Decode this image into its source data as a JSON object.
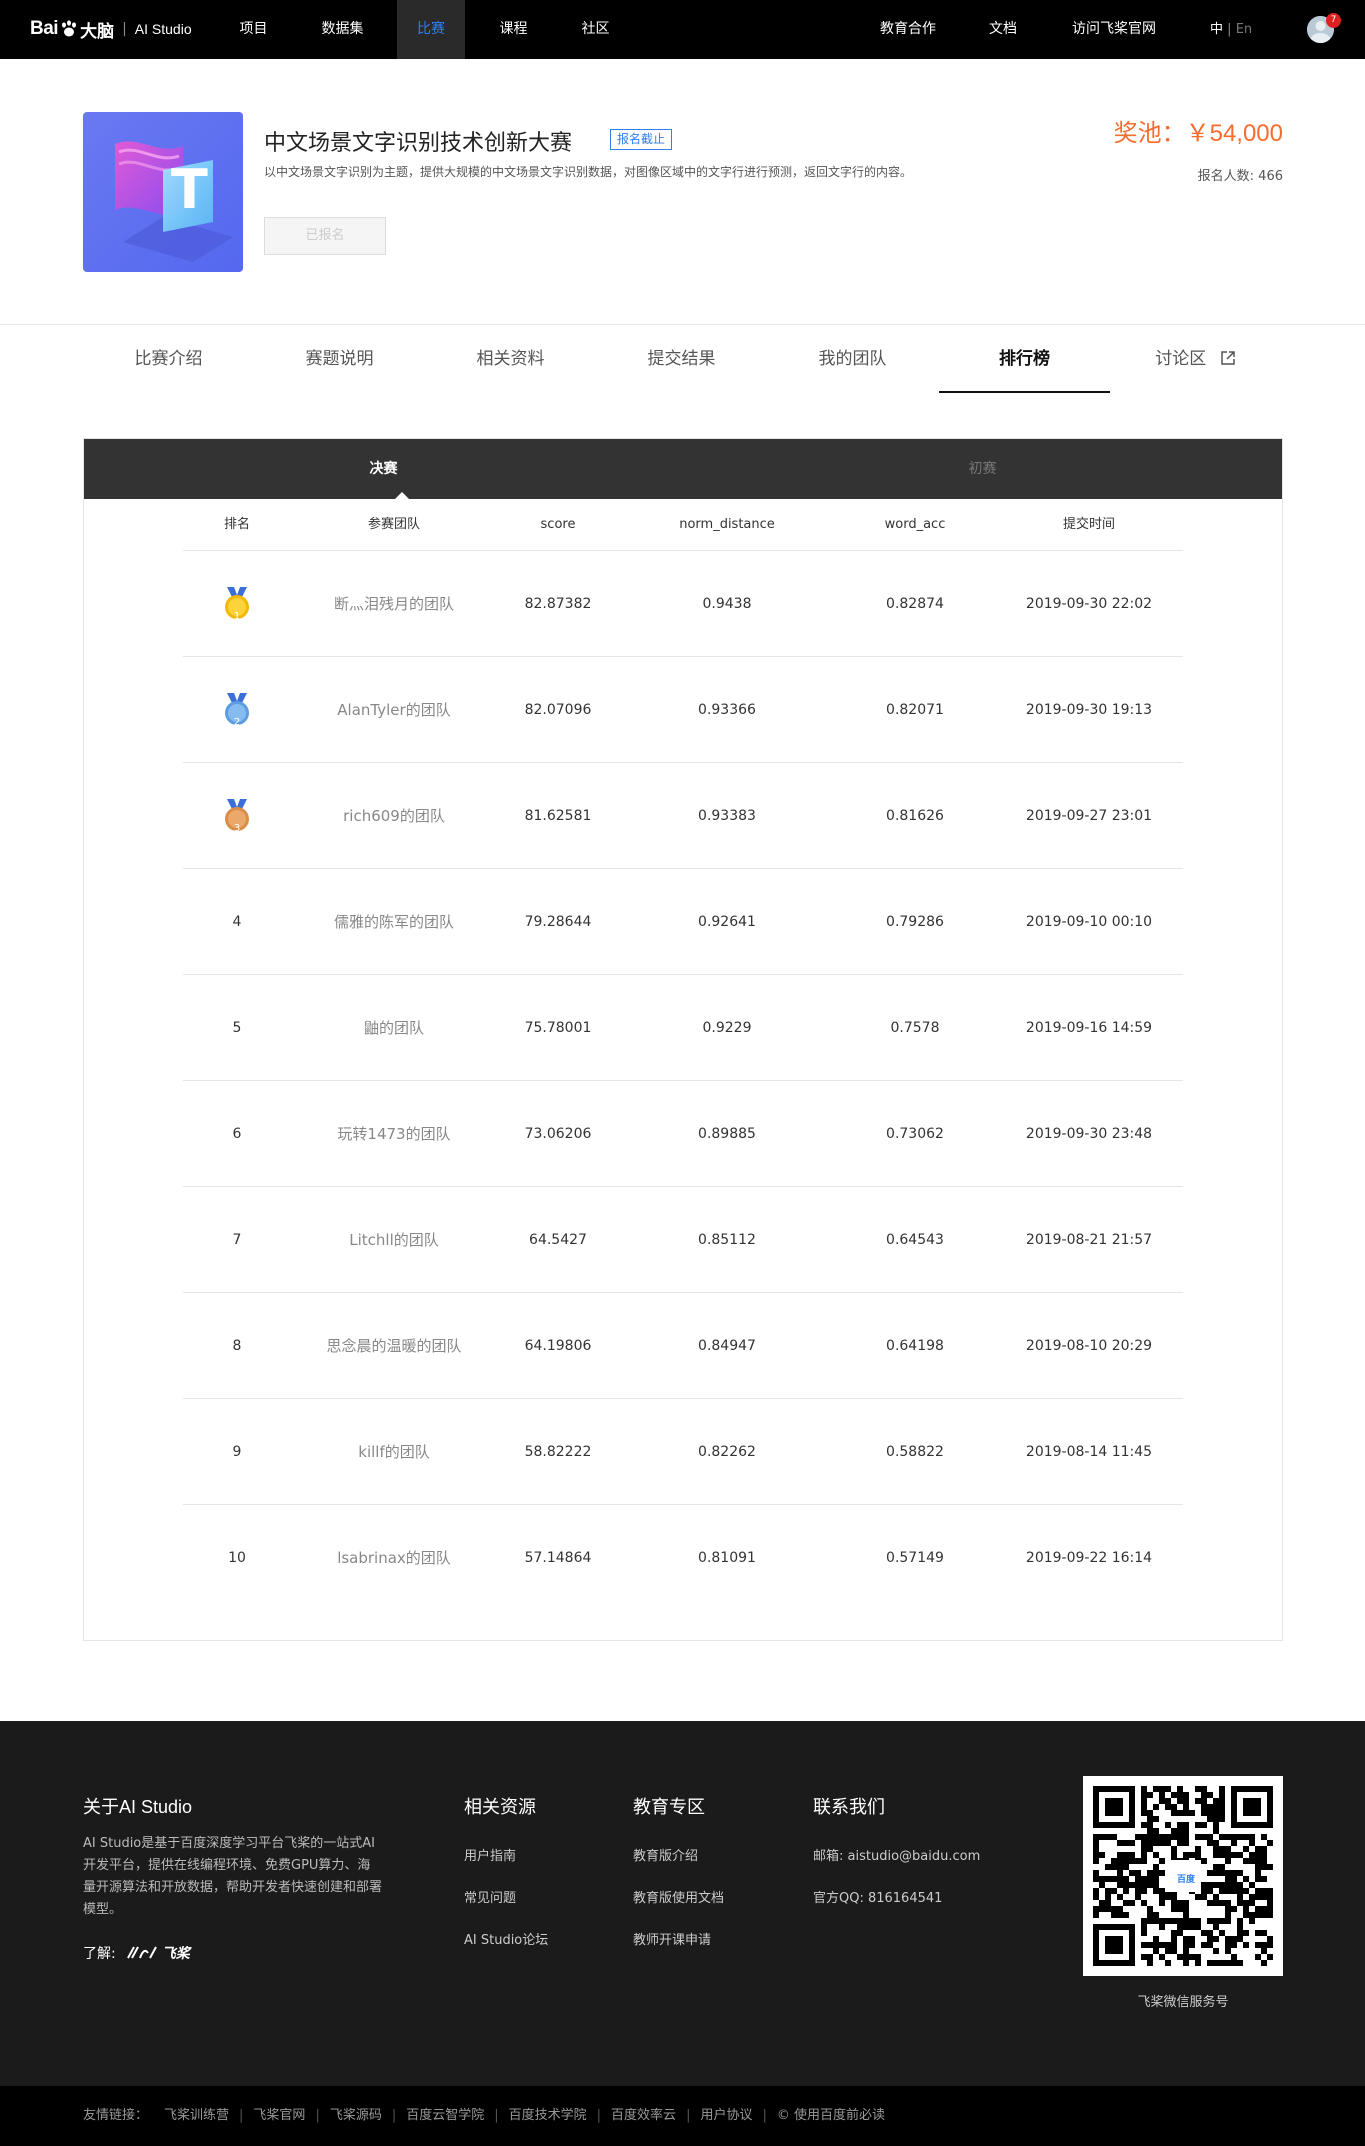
{
  "nav": {
    "brand_prefix": "Bai",
    "brand_suffix": "大脑",
    "brand_product": "AI Studio",
    "items": [
      "项目",
      "数据集",
      "比赛",
      "课程",
      "社区"
    ],
    "active": "比赛",
    "right_items": [
      "教育合作",
      "文档",
      "访问飞桨官网"
    ],
    "lang_zh": "中",
    "lang_sep": "|",
    "lang_en": "En",
    "notification_count": "7"
  },
  "competition": {
    "cover_letter": "T",
    "title": "中文场景文字识别技术创新大赛",
    "status_tag": "报名截止",
    "description": "以中文场景文字识别为主题，提供大规模的中文场景文字识别数据，对图像区域中的文字行进行预测，返回文字行的内容。",
    "signup_button": "已报名",
    "prize_label": "奖池：￥54,000",
    "signup_count": "报名人数: 466"
  },
  "tabs": [
    "比赛介绍",
    "赛题说明",
    "相关资料",
    "提交结果",
    "我的团队",
    "排行榜",
    "讨论区"
  ],
  "active_tab": "排行榜",
  "leaderboard": {
    "stages": [
      "决赛",
      "初赛"
    ],
    "active_stage": "决赛",
    "columns": [
      "排名",
      "参赛团队",
      "score",
      "norm_distance",
      "word_acc",
      "提交时间"
    ],
    "rows": [
      {
        "rank": "1",
        "team": "断灬泪残月的团队",
        "score": "82.87382",
        "norm_distance": "0.9438",
        "word_acc": "0.82874",
        "time": "2019-09-30 22:02",
        "medal": "gold"
      },
      {
        "rank": "2",
        "team": "AlanTyler的团队",
        "score": "82.07096",
        "norm_distance": "0.93366",
        "word_acc": "0.82071",
        "time": "2019-09-30 19:13",
        "medal": "silver"
      },
      {
        "rank": "3",
        "team": "rich609的团队",
        "score": "81.62581",
        "norm_distance": "0.93383",
        "word_acc": "0.81626",
        "time": "2019-09-27 23:01",
        "medal": "bronze"
      },
      {
        "rank": "4",
        "team": "儒雅的陈军的团队",
        "score": "79.28644",
        "norm_distance": "0.92641",
        "word_acc": "0.79286",
        "time": "2019-09-10 00:10"
      },
      {
        "rank": "5",
        "team": "鼬的团队",
        "score": "75.78001",
        "norm_distance": "0.9229",
        "word_acc": "0.7578",
        "time": "2019-09-16 14:59"
      },
      {
        "rank": "6",
        "team": "玩转1473的团队",
        "score": "73.06206",
        "norm_distance": "0.89885",
        "word_acc": "0.73062",
        "time": "2019-09-30 23:48"
      },
      {
        "rank": "7",
        "team": "Litchll的团队",
        "score": "64.5427",
        "norm_distance": "0.85112",
        "word_acc": "0.64543",
        "time": "2019-08-21 21:57"
      },
      {
        "rank": "8",
        "team": "思念晨的温暖的团队",
        "score": "64.19806",
        "norm_distance": "0.84947",
        "word_acc": "0.64198",
        "time": "2019-08-10 20:29"
      },
      {
        "rank": "9",
        "team": "killf的团队",
        "score": "58.82222",
        "norm_distance": "0.82262",
        "word_acc": "0.58822",
        "time": "2019-08-14 11:45"
      },
      {
        "rank": "10",
        "team": "lsabrinax的团队",
        "score": "57.14864",
        "norm_distance": "0.81091",
        "word_acc": "0.57149",
        "time": "2019-09-22 16:14"
      }
    ]
  },
  "footer": {
    "about_title": "关于AI Studio",
    "about_text": "AI Studio是基于百度深度学习平台飞桨的一站式AI开发平台，提供在线编程环境、免费GPU算力、海量开源算法和开放数据，帮助开发者快速创建和部署模型。",
    "learn_label": "了解:",
    "learn_brand": "飞桨",
    "resources_title": "相关资源",
    "resources": [
      "用户指南",
      "常见问题",
      "AI Studio论坛"
    ],
    "education_title": "教育专区",
    "education": [
      "教育版介绍",
      "教育版使用文档",
      "教师开课申请"
    ],
    "contact_title": "联系我们",
    "contact": [
      "邮箱: aistudio@baidu.com",
      "官方QQ: 816164541"
    ],
    "qr_caption": "飞桨微信服务号",
    "qr_logo_text": "百度"
  },
  "bottom_links": {
    "label": "友情链接：",
    "items": [
      "飞桨训练营",
      "飞桨官网",
      "飞桨源码",
      "百度云智学院",
      "百度技术学院",
      "百度效率云",
      "用户协议",
      "© 使用百度前必读"
    ]
  },
  "colors": {
    "accent_blue": "#2f80ed",
    "prize_orange": "#f56c2d",
    "nav_bg": "#000000",
    "footer_bg": "#1b1b1b"
  }
}
